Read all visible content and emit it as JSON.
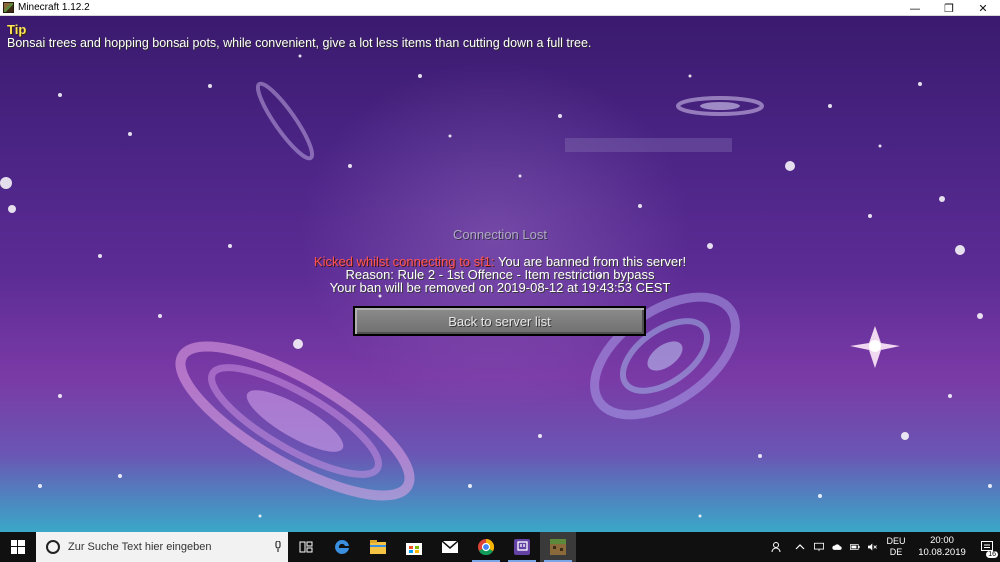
{
  "window": {
    "title": "Minecraft 1.12.2",
    "controls": {
      "minimize": "—",
      "maximize": "❐",
      "close": "✕"
    }
  },
  "tip": {
    "heading": "Tip",
    "text": "Bonsai trees and hopping bonsai pots, while convenient, give a lot less items than cutting down a full tree."
  },
  "disconnect": {
    "title": "Connection Lost",
    "kick_prefix": "Kicked whilst connecting to sf1:",
    "kick_message": " You are banned from this server!",
    "reason": "Reason: Rule 2 - 1st Offence - Item restriction bypass",
    "ban_expiry": "Your ban will be removed on 2019-08-12 at 19:43:53 CEST",
    "back_button": "Back to server list"
  },
  "taskbar": {
    "search_placeholder": "Zur Suche Text hier eingeben",
    "pinned": [
      {
        "name": "task-view-icon",
        "glyph": "⧉"
      },
      {
        "name": "edge-icon",
        "glyph": "e"
      },
      {
        "name": "file-explorer-icon",
        "glyph": "▬"
      },
      {
        "name": "store-icon",
        "glyph": "▦"
      },
      {
        "name": "mail-icon",
        "glyph": "✉"
      },
      {
        "name": "chrome-icon",
        "glyph": "◉"
      },
      {
        "name": "twitch-icon",
        "glyph": "▣"
      },
      {
        "name": "minecraft-icon",
        "glyph": "■"
      }
    ],
    "language_line1": "DEU",
    "language_line2": "DE",
    "time": "20:00",
    "date": "10.08.2019",
    "notification_count": "16"
  },
  "colors": {
    "tip_heading": "#ffe55a",
    "kick_red": "#ff5555",
    "accent_blue": "#7aa6e8"
  }
}
